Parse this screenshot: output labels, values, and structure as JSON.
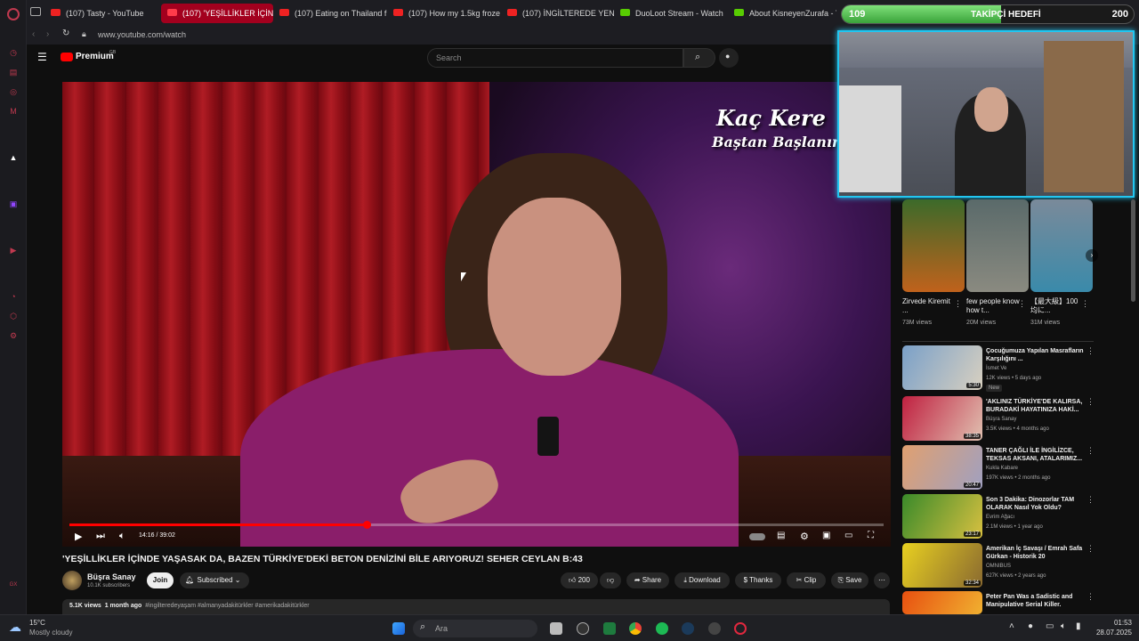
{
  "tabs": [
    {
      "label": "(107) Tasty - YouTube"
    },
    {
      "label": "(107) 'YEŞİLLİKLER İÇİND"
    },
    {
      "label": "(107) Eating on Thailand f"
    },
    {
      "label": "(107) How my 1.5kg froze"
    },
    {
      "label": "(107) İNGİLTEREDE YENİ"
    },
    {
      "label": "DuoLoot Stream - Watch"
    },
    {
      "label": "About KisneyenZurafa - Y"
    }
  ],
  "address": {
    "url": "www.youtube.com/watch"
  },
  "header": {
    "logo": "Premium",
    "logo_badge": "GB",
    "search_placeholder": "Search"
  },
  "video": {
    "overlay_title": "Kaç Kere",
    "overlay_subtitle": "Baştan Başlanır",
    "time": "14:16 / 39:02",
    "progress": 0.3655,
    "title": "'YEŞİLLİKLER İÇİNDE YAŞASAK DA, BAZEN TÜRKİYE'DEKİ BETON DENİZİNİ BİLE ARIYORUZ! SEHER CEYLAN B:43"
  },
  "channel": {
    "name": "Büşra Sanay",
    "subs": "10.1K subscribers",
    "join": "Join",
    "subscribed": "Subscribed"
  },
  "actions": {
    "likes": "200",
    "share": "Share",
    "download": "Download",
    "thanks": "Thanks",
    "clip": "Clip",
    "save": "Save"
  },
  "description": {
    "views": "5.1K views",
    "age": "1 month ago",
    "tags": "#ingilteredeyaşam #almanyadakitürkler #amerikadakitürkler"
  },
  "follower_goal": {
    "current": "109",
    "label": "TAKİPÇİ HEDEFİ",
    "target": "200",
    "progress": 0.545
  },
  "shorts": [
    {
      "title": "Zirvede Kiremit ...",
      "views": "73M views"
    },
    {
      "title": "few people know how t...",
      "views": "20M views"
    },
    {
      "title": "【最大級】100均に...",
      "views": "31M views"
    }
  ],
  "recommended": [
    {
      "title": "Çocuğumuza Yapılan Masrafların Karşılığını ...",
      "channel": "İsmet Ve",
      "meta": "12K views • 5 days ago",
      "badge": "New",
      "duration": "5:30"
    },
    {
      "title": "'AKLINIZ TÜRKİYE'DE KALIRSA, BURADAKİ HAYATINIZA HAKİ...",
      "channel": "Büşra Sanay",
      "meta": "3.5K views • 4 months ago",
      "badge": "",
      "duration": "38:35"
    },
    {
      "title": "TANER ÇAĞLI İLE İNGİLİZCE, TEKSAS AKSANI, ATALARIMIZ...",
      "channel": "Kukla Kabare",
      "meta": "197K views • 2 months ago",
      "badge": "",
      "duration": "20:47"
    },
    {
      "title": "Son 3 Dakika: Dinozorlar TAM OLARAK Nasıl Yok Oldu?",
      "channel": "Evrim Ağacı",
      "meta": "2.1M views • 1 year ago",
      "badge": "",
      "duration": "23:17"
    },
    {
      "title": "Amerikan İç Savaşı / Emrah Safa Gürkan - Historik 20",
      "channel": "OMNIBUS",
      "meta": "627K views • 2 years ago",
      "badge": "",
      "duration": "32:34"
    },
    {
      "title": "Peter Pan Was a Sadistic and Manipulative Serial Killer.",
      "channel": "",
      "meta": "",
      "badge": "",
      "duration": ""
    }
  ],
  "taskbar": {
    "weather_temp": "15°C",
    "weather_desc": "Mostly cloudy",
    "search": "Ara",
    "time": "01:53",
    "date": "28.07.2025"
  },
  "colors": {
    "accent": "#ff0000",
    "webcam_border": "#22c6f0",
    "goal_fill": "#58c24a",
    "active_tab": "#a3001e"
  }
}
